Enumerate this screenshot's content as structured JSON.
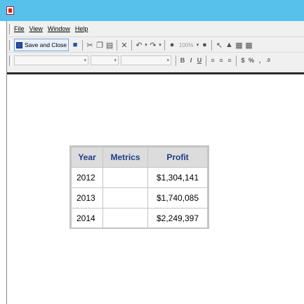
{
  "menu": {
    "items": [
      "File",
      "View",
      "Window",
      "Help"
    ]
  },
  "toolbar": {
    "save_close_label": "Save and Close",
    "zoom_value": "100%"
  },
  "table": {
    "headers": [
      "Year",
      "Metrics",
      "Profit"
    ],
    "rows": [
      {
        "year": "2012",
        "metrics": "",
        "profit": "$1,304,141"
      },
      {
        "year": "2013",
        "metrics": "",
        "profit": "$1,740,085"
      },
      {
        "year": "2014",
        "metrics": "",
        "profit": "$2,249,397"
      }
    ]
  },
  "icons": {
    "app": "document-icon",
    "save": "floppy-icon",
    "cut": "scissors-icon",
    "copy": "copy-icon",
    "paste": "paste-icon",
    "delete": "x-icon",
    "undo": "undo-icon",
    "redo": "redo-icon",
    "bold": "bold-icon",
    "italic": "italic-icon",
    "underline": "underline-icon",
    "currency": "dollar-icon",
    "percent": "percent-icon"
  },
  "colors": {
    "titlebar": "#57c1ec",
    "header_text": "#1f3d86",
    "header_bg": "#dcdcdc",
    "grid_border": "#c5c5c5"
  }
}
